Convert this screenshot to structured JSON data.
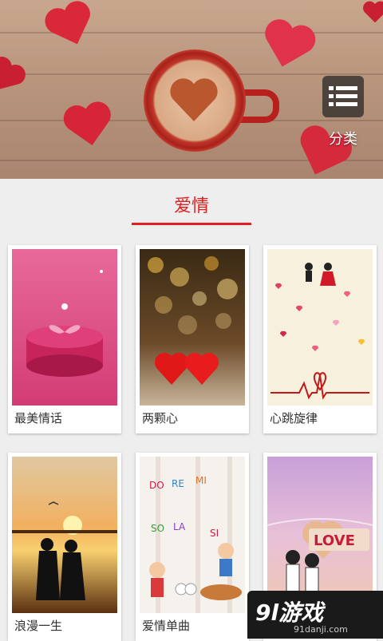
{
  "banner": {
    "category_label": "分类",
    "category_icon": "list-icon"
  },
  "section": {
    "title": "爱情",
    "accent_color": "#e02020"
  },
  "cards": [
    {
      "label": "最美情话"
    },
    {
      "label": "两颗心"
    },
    {
      "label": "心跳旋律"
    },
    {
      "label": "浪漫一生"
    },
    {
      "label": "爱情单曲"
    },
    {
      "label": ""
    }
  ],
  "watermark": {
    "logo": "9l游戏",
    "url": "91danji.com"
  }
}
